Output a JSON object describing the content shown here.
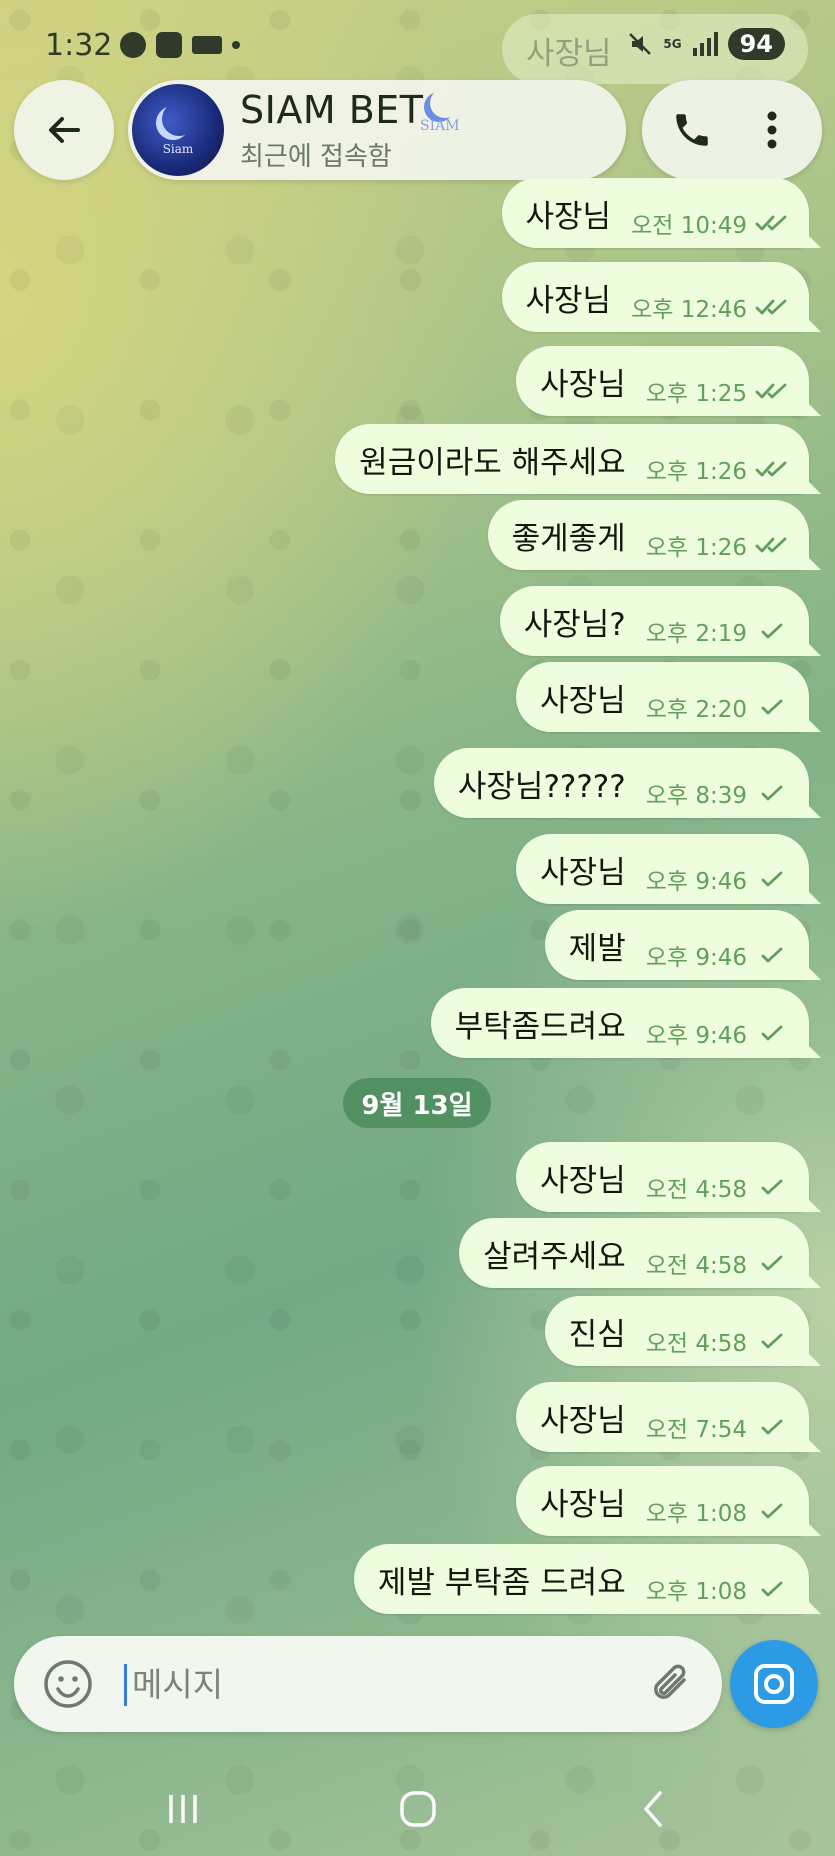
{
  "status_bar": {
    "time": "1:32",
    "network": "5G",
    "battery": "94",
    "icons": [
      "play-circle-icon",
      "youtube-icon",
      "app-icon",
      "dot-icon",
      "mute-icon",
      "signal-icon",
      "battery-icon"
    ]
  },
  "header": {
    "back_icon": "arrow-left-icon",
    "chat_name": "SIAM BET",
    "status": "최근에 접속함",
    "avatar_text": "Siam",
    "badge_text": "SIAM",
    "call_icon": "phone-icon",
    "more_icon": "more-vertical-icon"
  },
  "ghost_message": {
    "text": "사장님"
  },
  "messages": [
    {
      "text": "사장님",
      "time": "오전 10:49",
      "status": "read"
    },
    {
      "text": "사장님",
      "time": "오후 12:46",
      "status": "read"
    },
    {
      "text": "사장님",
      "time": "오후 1:25",
      "status": "read"
    },
    {
      "text": "원금이라도 해주세요",
      "time": "오후 1:26",
      "status": "read"
    },
    {
      "text": "좋게좋게",
      "time": "오후 1:26",
      "status": "read"
    },
    {
      "text": "사장님?",
      "time": "오후 2:19",
      "status": "sent"
    },
    {
      "text": "사장님",
      "time": "오후 2:20",
      "status": "sent"
    },
    {
      "text": "사장님?????",
      "time": "오후 8:39",
      "status": "sent"
    },
    {
      "text": "사장님",
      "time": "오후 9:46",
      "status": "sent"
    },
    {
      "text": "제발",
      "time": "오후 9:46",
      "status": "sent"
    },
    {
      "text": "부탁좀드려요",
      "time": "오후 9:46",
      "status": "sent"
    },
    {
      "text": "사장님",
      "time": "오전 4:58",
      "status": "sent"
    },
    {
      "text": "살려주세요",
      "time": "오전 4:58",
      "status": "sent"
    },
    {
      "text": "진심",
      "time": "오전 4:58",
      "status": "sent"
    },
    {
      "text": "사장님",
      "time": "오전 7:54",
      "status": "sent"
    },
    {
      "text": "사장님",
      "time": "오후 1:08",
      "status": "sent"
    },
    {
      "text": "제발 부탁좀 드려요",
      "time": "오후 1:08",
      "status": "sent"
    }
  ],
  "date_separator": "9월 13일",
  "input": {
    "placeholder": "메시지",
    "value": "",
    "emoji_icon": "smiley-icon",
    "attach_icon": "paperclip-icon",
    "camera_icon": "camera-icon"
  },
  "nav_bar": {
    "icons": [
      "recents-icon",
      "home-icon",
      "back-icon"
    ]
  },
  "colors": {
    "bubble": "#effddf",
    "time_text": "#5fa05a",
    "check": "#5fa05a",
    "date_chip": "#4c8c5c",
    "camera_button": "#2d9ae6"
  }
}
